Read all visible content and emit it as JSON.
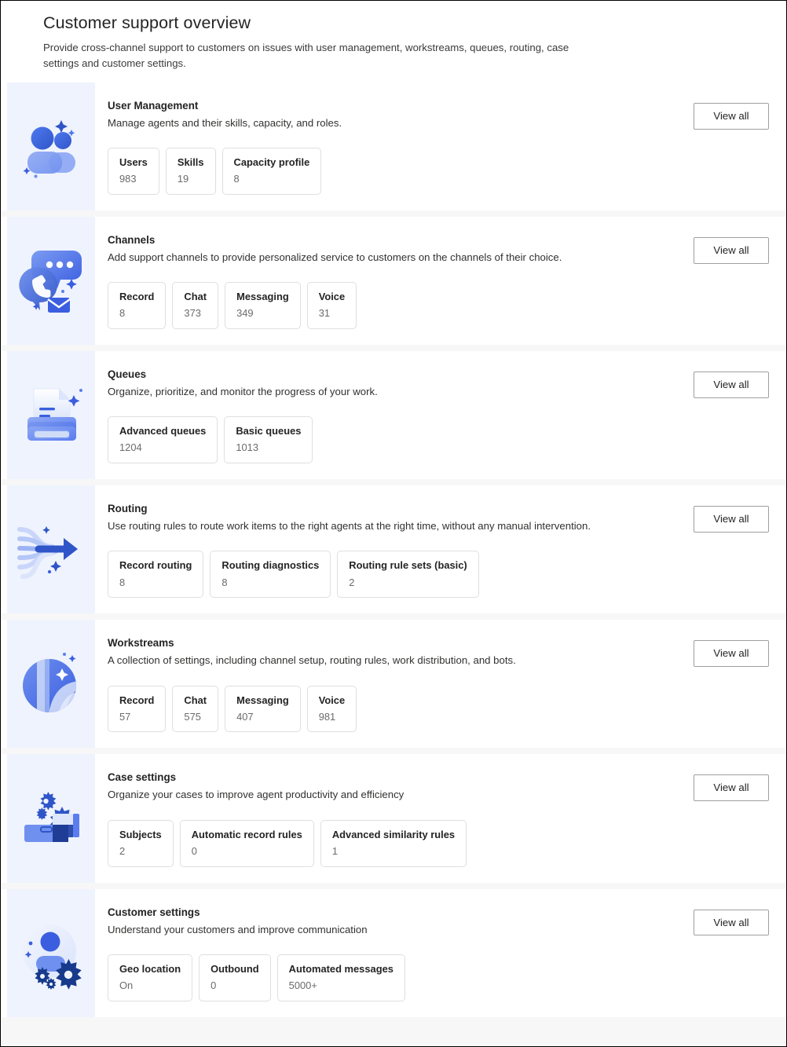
{
  "header": {
    "title": "Customer support overview",
    "subtitle": "Provide cross-channel support to customers on issues with user management, workstreams, queues, routing, case settings and customer settings."
  },
  "common": {
    "view_all_label": "View all"
  },
  "colors": {
    "accent_blue": "#3b5ee0",
    "icon_panel_bg": "#eff3fd",
    "card_bg": "#ffffff",
    "page_bg": "#f7f7f7",
    "tile_border": "#e1dfdd",
    "button_border": "#a19f9d",
    "value_text": "#6b6b6b"
  },
  "cards": [
    {
      "icon": "users-group-icon",
      "title": "User Management",
      "description": "Manage agents and their skills, capacity, and roles.",
      "view_all_label": "View all",
      "tiles": [
        {
          "label": "Users",
          "value": "983"
        },
        {
          "label": "Skills",
          "value": "19"
        },
        {
          "label": "Capacity profile",
          "value": "8"
        }
      ]
    },
    {
      "icon": "chat-channels-icon",
      "title": "Channels",
      "description": "Add support channels to provide personalized service to customers on the channels of their choice.",
      "view_all_label": "View all",
      "tiles": [
        {
          "label": "Record",
          "value": "8"
        },
        {
          "label": "Chat",
          "value": "373"
        },
        {
          "label": "Messaging",
          "value": "349"
        },
        {
          "label": "Voice",
          "value": "31"
        }
      ]
    },
    {
      "icon": "queue-document-tray-icon",
      "title": "Queues",
      "description": "Organize, prioritize, and monitor the progress of your work.",
      "view_all_label": "View all",
      "tiles": [
        {
          "label": "Advanced queues",
          "value": "1204"
        },
        {
          "label": "Basic queues",
          "value": "1013"
        }
      ]
    },
    {
      "icon": "routing-arrow-icon",
      "title": "Routing",
      "description": "Use routing rules to route work items to the right agents at the right time, without any manual intervention.",
      "view_all_label": "View all",
      "tiles": [
        {
          "label": "Record routing",
          "value": "8"
        },
        {
          "label": "Routing diagnostics",
          "value": "8"
        },
        {
          "label": "Routing rule sets (basic)",
          "value": "2"
        }
      ]
    },
    {
      "icon": "workstreams-sphere-icon",
      "title": "Workstreams",
      "description": "A collection of settings, including channel setup, routing rules, work distribution, and bots.",
      "view_all_label": "View all",
      "tiles": [
        {
          "label": "Record",
          "value": "57"
        },
        {
          "label": "Chat",
          "value": "575"
        },
        {
          "label": "Messaging",
          "value": "407"
        },
        {
          "label": "Voice",
          "value": "981"
        }
      ]
    },
    {
      "icon": "case-briefcase-gears-icon",
      "title": "Case settings",
      "description": "Organize your cases to improve agent productivity and efficiency",
      "view_all_label": "View all",
      "tiles": [
        {
          "label": "Subjects",
          "value": "2"
        },
        {
          "label": "Automatic record rules",
          "value": "0"
        },
        {
          "label": "Advanced similarity rules",
          "value": "1"
        }
      ]
    },
    {
      "icon": "customer-person-gears-icon",
      "title": "Customer settings",
      "description": "Understand your customers and improve communication",
      "view_all_label": "View all",
      "tiles": [
        {
          "label": "Geo location",
          "value": "On"
        },
        {
          "label": "Outbound",
          "value": "0"
        },
        {
          "label": "Automated messages",
          "value": "5000+"
        }
      ]
    }
  ]
}
